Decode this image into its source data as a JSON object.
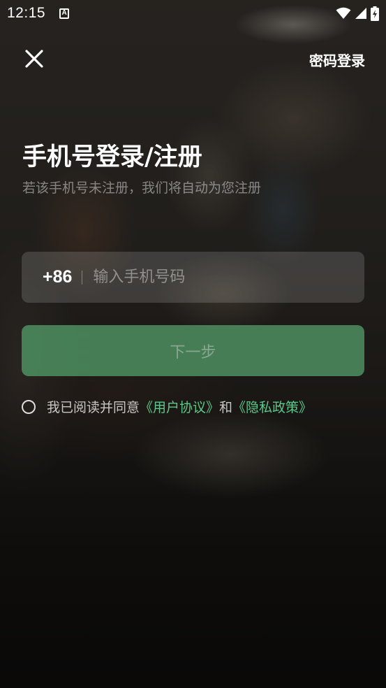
{
  "status_bar": {
    "time": "12:15",
    "notification_icon_letter": "A",
    "icons": [
      "wifi-icon",
      "signal-icon",
      "battery-charging-icon"
    ]
  },
  "header": {
    "close_icon": "close-icon",
    "password_login_label": "密码登录"
  },
  "main": {
    "title": "手机号登录/注册",
    "subtitle": "若该手机号未注册，我们将自动为您注册",
    "phone": {
      "country_code": "+86",
      "value": "",
      "placeholder": "输入手机号码"
    },
    "next_button_label": "下一步",
    "agreement": {
      "prefix": "我已阅读并同意",
      "user_agreement": "《用户协议》",
      "conjunction": "和",
      "privacy_policy": "《隐私政策》",
      "checked": false
    }
  },
  "colors": {
    "accent_green": "#5cc98a",
    "button_green": "#4e8f60"
  }
}
